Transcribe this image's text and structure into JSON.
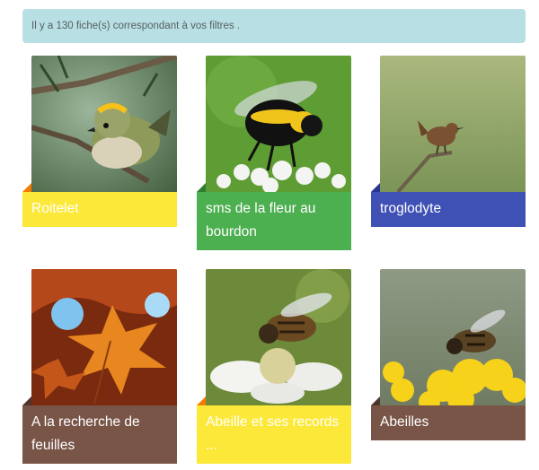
{
  "results": {
    "message": "Il y a 130 fiche(s) correspondant à vos filtres ."
  },
  "cards": [
    {
      "title": "Roitelet"
    },
    {
      "title": "sms de la fleur au bourdon"
    },
    {
      "title": "troglodyte"
    },
    {
      "title": "A la recherche de feuilles"
    },
    {
      "title": "Abeille et ses records ..."
    },
    {
      "title": "Abeilles"
    }
  ],
  "colors": {
    "yellow": "#fce838",
    "green": "#4caf50",
    "blue": "#3f51b5",
    "brown": "#795548",
    "alert": "#b8dfe3"
  }
}
